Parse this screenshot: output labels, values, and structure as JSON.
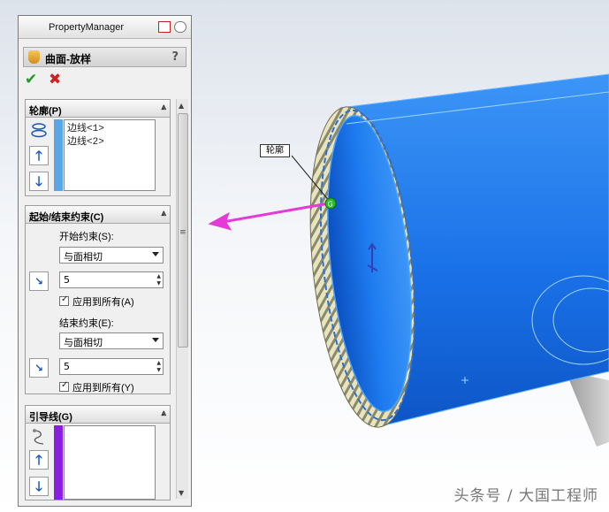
{
  "panel": {
    "title": "PropertyManager",
    "feature_name": "曲面-放样",
    "help": "?"
  },
  "profile_group": {
    "title": "轮廓(P)",
    "items": [
      "边线<1>",
      "边线<2>"
    ],
    "bar_color": "#5aa6e6"
  },
  "constraint_group": {
    "title": "起始/结束约束(C)",
    "start_label": "开始约束(S):",
    "start_value": "与面相切",
    "start_amount": "5",
    "start_apply_all": "应用到所有(A)",
    "end_label": "结束约束(E):",
    "end_value": "与面相切",
    "end_amount": "5",
    "end_apply_all": "应用到所有(Y)"
  },
  "guide_group": {
    "title": "引导线(G)",
    "bar_color": "#8b1fe0"
  },
  "viewport": {
    "callout_label": "轮廓",
    "body_color": "#1e7cf0",
    "arrow_color": "#e63ad8"
  },
  "watermark": "头条号 / 大国工程师"
}
